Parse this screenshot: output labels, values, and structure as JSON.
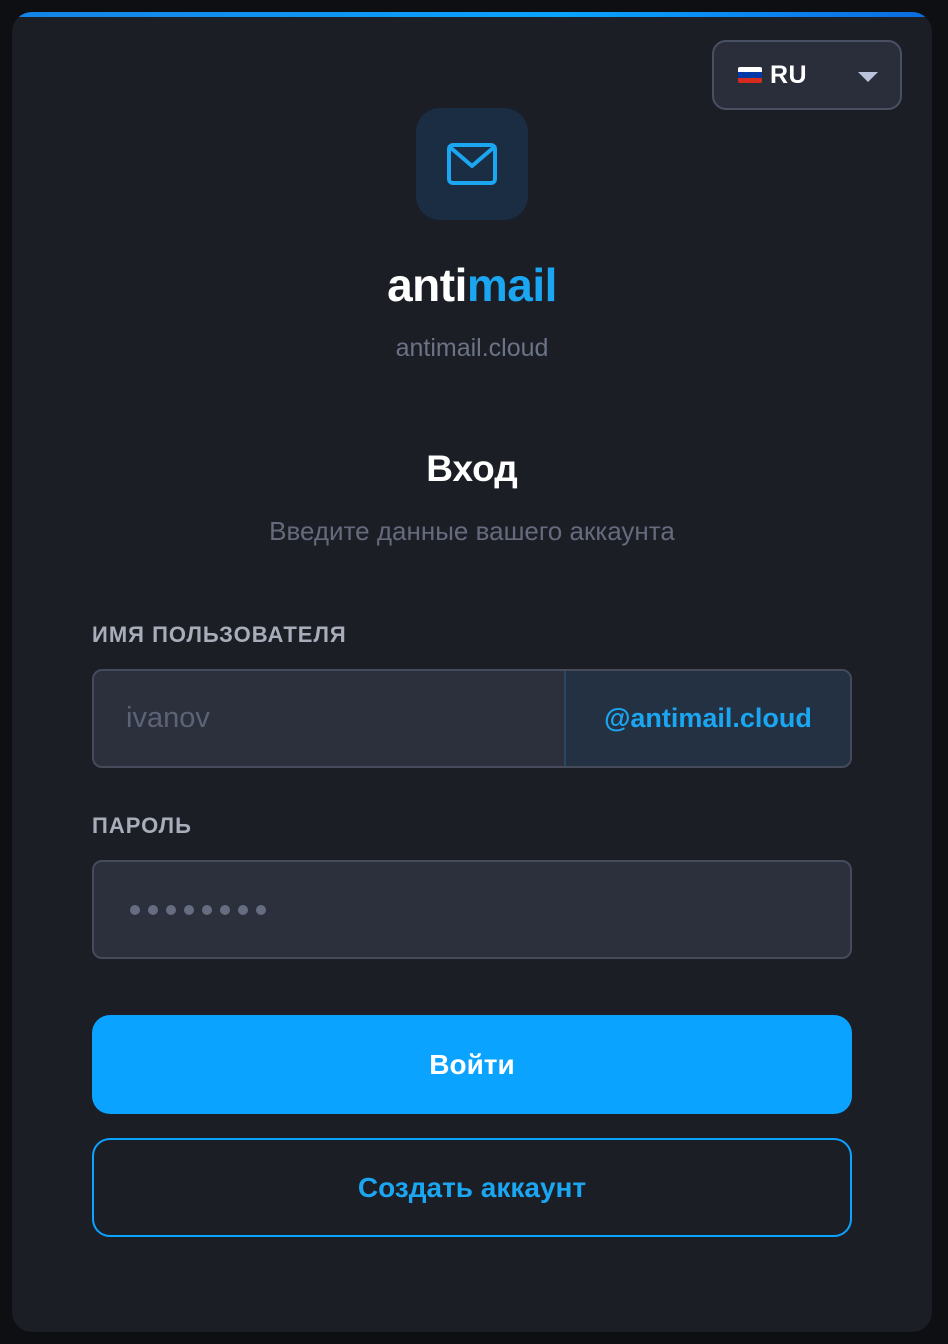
{
  "language": {
    "code": "RU",
    "flag_icon": "russia-flag-icon",
    "flag_colors": [
      "#ffffff",
      "#0039a6",
      "#d52b1e"
    ]
  },
  "brand": {
    "logo_icon": "mail-envelope-icon",
    "name_part1": "anti",
    "name_part2": "mail",
    "domain": "antimail.cloud"
  },
  "form": {
    "title": "Вход",
    "subtitle": "Введите данные вашего аккаунта",
    "username": {
      "label": "ИМЯ ПОЛЬЗОВАТЕЛЯ",
      "placeholder": "ivanov",
      "value": "",
      "suffix": "@antimail.cloud"
    },
    "password": {
      "label": "ПАРОЛЬ",
      "placeholder": "••••••••",
      "value": ""
    },
    "login_button": "Войти",
    "register_button": "Создать аккаунт"
  },
  "colors": {
    "accent": "#0aa3ff",
    "card_background": "#1c1e26",
    "input_background": "#2c2f3c"
  }
}
